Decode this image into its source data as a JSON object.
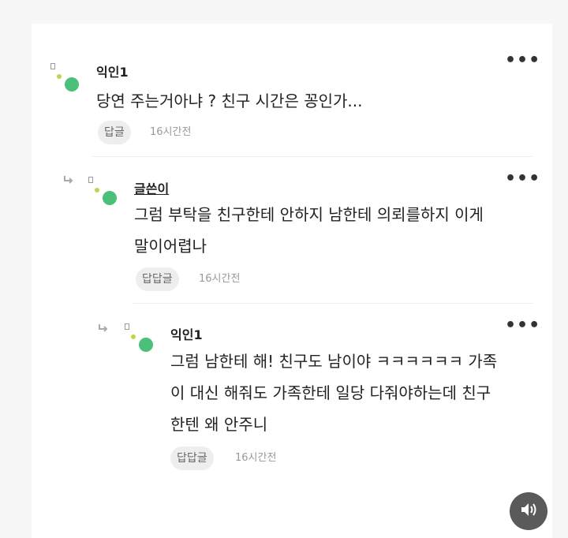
{
  "comments": [
    {
      "author": "익인1",
      "text_lines": [
        "당연 주는거아냐 ? 친구 시간은 꽁인가..."
      ],
      "reply_label": "답글",
      "time": "16시간전"
    },
    {
      "author": "글쓴이",
      "text_lines": [
        "그럼 부탁을 친구한테 안하지 남한테 의뢰를하지 이게",
        "말이어렵나"
      ],
      "reply_label": "답답글",
      "time": "16시간전"
    },
    {
      "author": "익인1",
      "text_lines": [
        "그럼 남한테 해! 친구도 남이야 ㅋㅋㅋㅋㅋㅋ 가족",
        "이 대신 해줘도 가족한테 일당 다줘야하는데 친구",
        "한텐 왜 안주니"
      ],
      "reply_label": "답답글",
      "time": "16시간전"
    }
  ],
  "icons": {
    "more": "more-options-icon",
    "reply_arrow": "reply-arrow-icon",
    "sound": "speaker-icon"
  },
  "colors": {
    "avatar_green": "#4cc07a",
    "avatar_lime": "#b9d94a",
    "sound_button": "#5a5a5a"
  }
}
